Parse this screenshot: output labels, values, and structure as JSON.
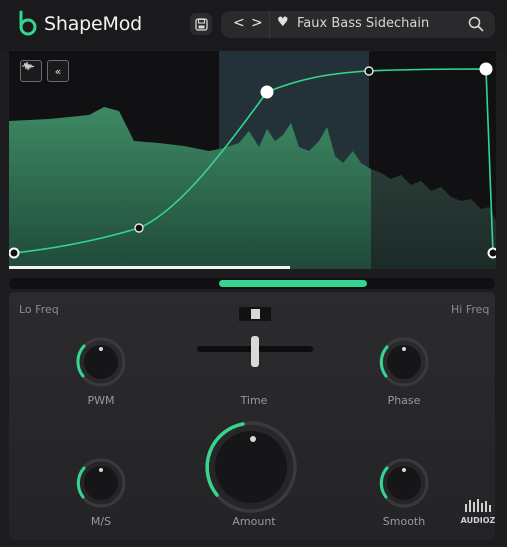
{
  "header": {
    "app_title": "ShapeMod",
    "preset_name": "Faux Bass Sidechain",
    "prev_arrow": "<",
    "next_arrow": ">"
  },
  "graph": {
    "tools": [
      "waveform-icon",
      "collapse-left-icon"
    ]
  },
  "labels": {
    "lo_freq": "Lo Freq",
    "hi_freq": "Hi Freq"
  },
  "knobs": {
    "pwm": "PWM",
    "time": "Time",
    "phase": "Phase",
    "amount": "Amount",
    "ms": "M/S",
    "smooth": "Smooth"
  },
  "watermark": "AUDIOZ",
  "colors": {
    "accent": "#34d68f",
    "background": "#1d1d1f"
  }
}
